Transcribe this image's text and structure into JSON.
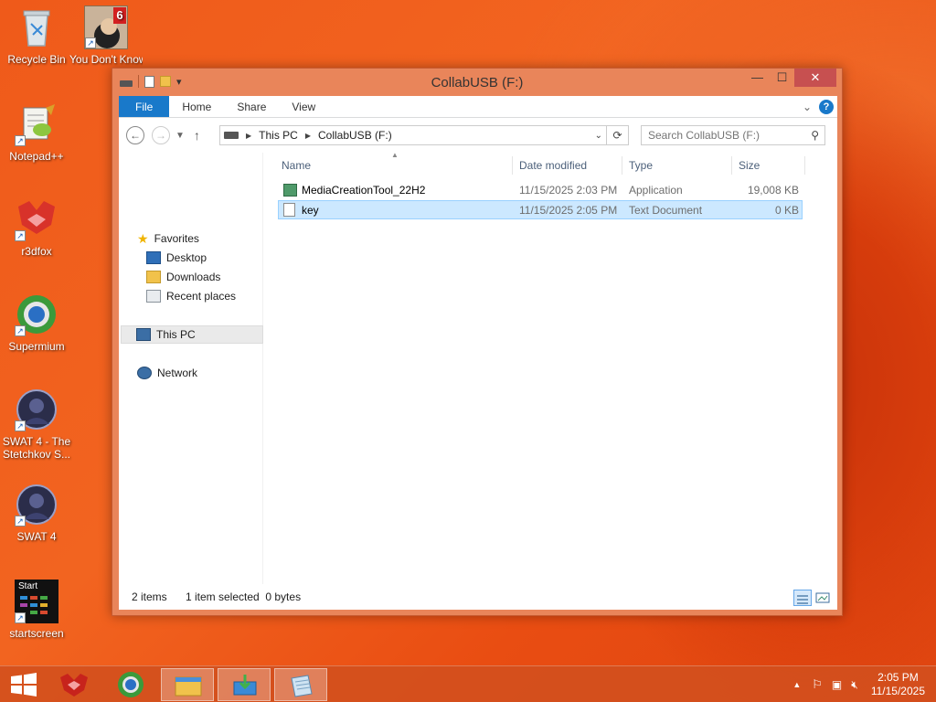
{
  "desktop": {
    "icons": [
      {
        "label": "Recycle Bin"
      },
      {
        "label": "You Don't Know Ja..."
      },
      {
        "label": "Notepad++"
      },
      {
        "label": "r3dfox"
      },
      {
        "label": "Supermium"
      },
      {
        "label": "SWAT 4 - The Stetchkov S..."
      },
      {
        "label": "SWAT 4"
      },
      {
        "label": "startscreen"
      }
    ],
    "startscreen_tile_text": "Start",
    "ydkj_badge": "6"
  },
  "window": {
    "title": "CollabUSB (F:)",
    "qat_dropdown": "▾",
    "controls": {
      "minimize": "—",
      "maximize": "☐",
      "close": "✕"
    },
    "ribbon": {
      "tabs": [
        "File",
        "Home",
        "Share",
        "View"
      ],
      "help": "?"
    },
    "address": {
      "crumbs": [
        "This PC",
        "CollabUSB (F:)"
      ]
    },
    "search": {
      "placeholder": "Search CollabUSB (F:)"
    },
    "nav": {
      "favorites": "Favorites",
      "desktop": "Desktop",
      "downloads": "Downloads",
      "recent": "Recent places",
      "this_pc": "This PC",
      "network": "Network"
    },
    "columns": {
      "name": "Name",
      "date": "Date modified",
      "type": "Type",
      "size": "Size"
    },
    "files": [
      {
        "name": "MediaCreationTool_22H2",
        "date": "11/15/2025 2:03 PM",
        "type": "Application",
        "size": "19,008 KB"
      },
      {
        "name": "key",
        "date": "11/15/2025 2:05 PM",
        "type": "Text Document",
        "size": "0 KB"
      }
    ],
    "status": {
      "items": "2 items",
      "selected": "1 item selected  0 bytes"
    }
  },
  "taskbar": {
    "clock_time": "2:05 PM",
    "clock_date": "11/15/2025"
  },
  "colors": {
    "accent": "#1979ca",
    "window_frame": "#e9855a",
    "selection": "#cce8ff",
    "desktop": "#f26420"
  }
}
